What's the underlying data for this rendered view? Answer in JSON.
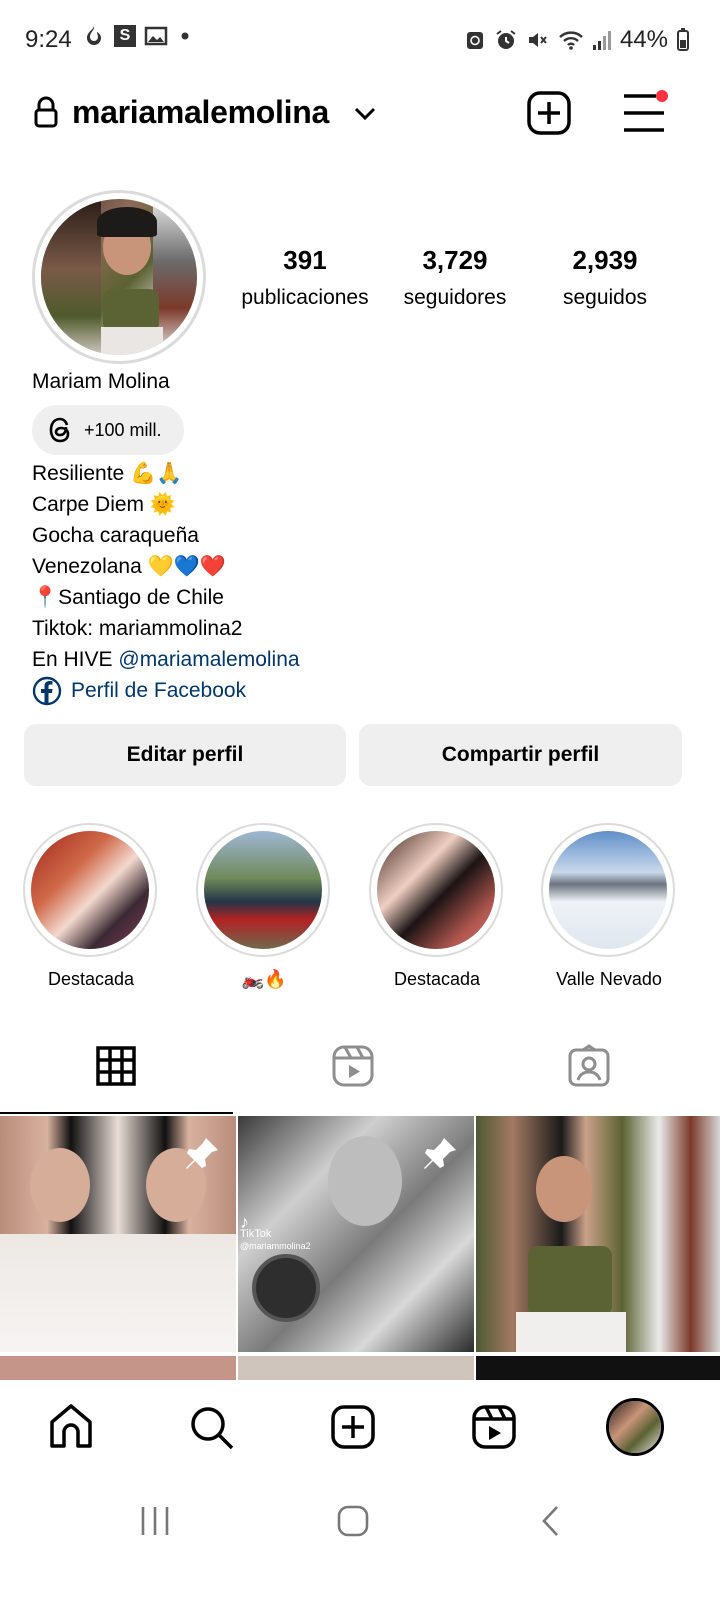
{
  "status_bar": {
    "time": "9:24",
    "battery": "44%"
  },
  "header": {
    "username": "mariamalemolina"
  },
  "profile": {
    "stats": [
      {
        "value": "391",
        "label": "publicaciones"
      },
      {
        "value": "3,729",
        "label": "seguidores"
      },
      {
        "value": "2,939",
        "label": "seguidos"
      }
    ],
    "name": "Mariam Molina",
    "threads_badge": "+100 mill.",
    "bio": [
      "Resiliente 💪🙏",
      "Carpe Diem 🌞",
      "Gocha caraqueña",
      "Venezolana 💛💙❤️",
      "📍Santiago de Chile",
      "Tiktok: mariammolina2"
    ],
    "bio_hive_prefix": "En HIVE ",
    "bio_hive_mention": "@mariamalemolina",
    "facebook_link": "Perfil de Facebook"
  },
  "buttons": {
    "edit": "Editar perfil",
    "share": "Compartir perfil"
  },
  "highlights": [
    {
      "label": "Destacada"
    },
    {
      "label": "🏍️🔥"
    },
    {
      "label": "Destacada"
    },
    {
      "label": "Valle Nevado"
    }
  ],
  "grid": {
    "tiktok_label": "TikTok",
    "tiktok_handle": "@mariammolina2"
  },
  "colors": {
    "accent_link": "#00376b",
    "notification_dot": "#ff3040",
    "button_bg": "#efefef"
  }
}
